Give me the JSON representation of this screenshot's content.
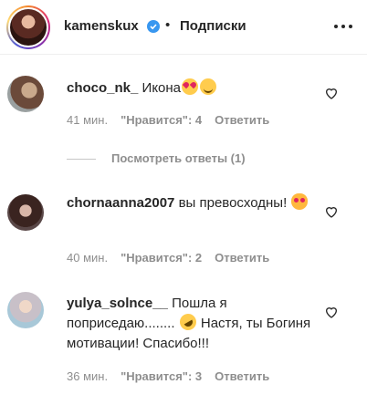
{
  "header": {
    "username": "kamenskux",
    "separator": "•",
    "follow_label": "Подписки",
    "verified_icon": "verified-badge",
    "more_icon": "more-horizontal"
  },
  "comments": [
    {
      "username": "choco_nk_",
      "text": "Икона",
      "emojis": [
        "heart-eyes",
        "blush"
      ],
      "time": "41 мин.",
      "likes": "\"Нравится\": 4",
      "reply": "Ответить"
    },
    {
      "username": "chornaanna2007",
      "text": "вы превосходны!",
      "emojis": [
        "heart-eyes-cat"
      ],
      "time": "40 мин.",
      "likes": "\"Нравится\": 2",
      "reply": "Ответить"
    },
    {
      "username": "yulya_solnce__",
      "text_before": "Пошла я поприседаю........",
      "text_after": "Настя, ты Богиня мотивации! Спасибо!!!",
      "emojis": [
        "rofl"
      ],
      "time": "36 мин.",
      "likes": "\"Нравится\": 3",
      "reply": "Ответить"
    }
  ],
  "view_replies": "Посмотреть ответы (1)",
  "colors": {
    "text": "#262626",
    "meta": "#8e8e8e",
    "verified": "#3897f0"
  }
}
